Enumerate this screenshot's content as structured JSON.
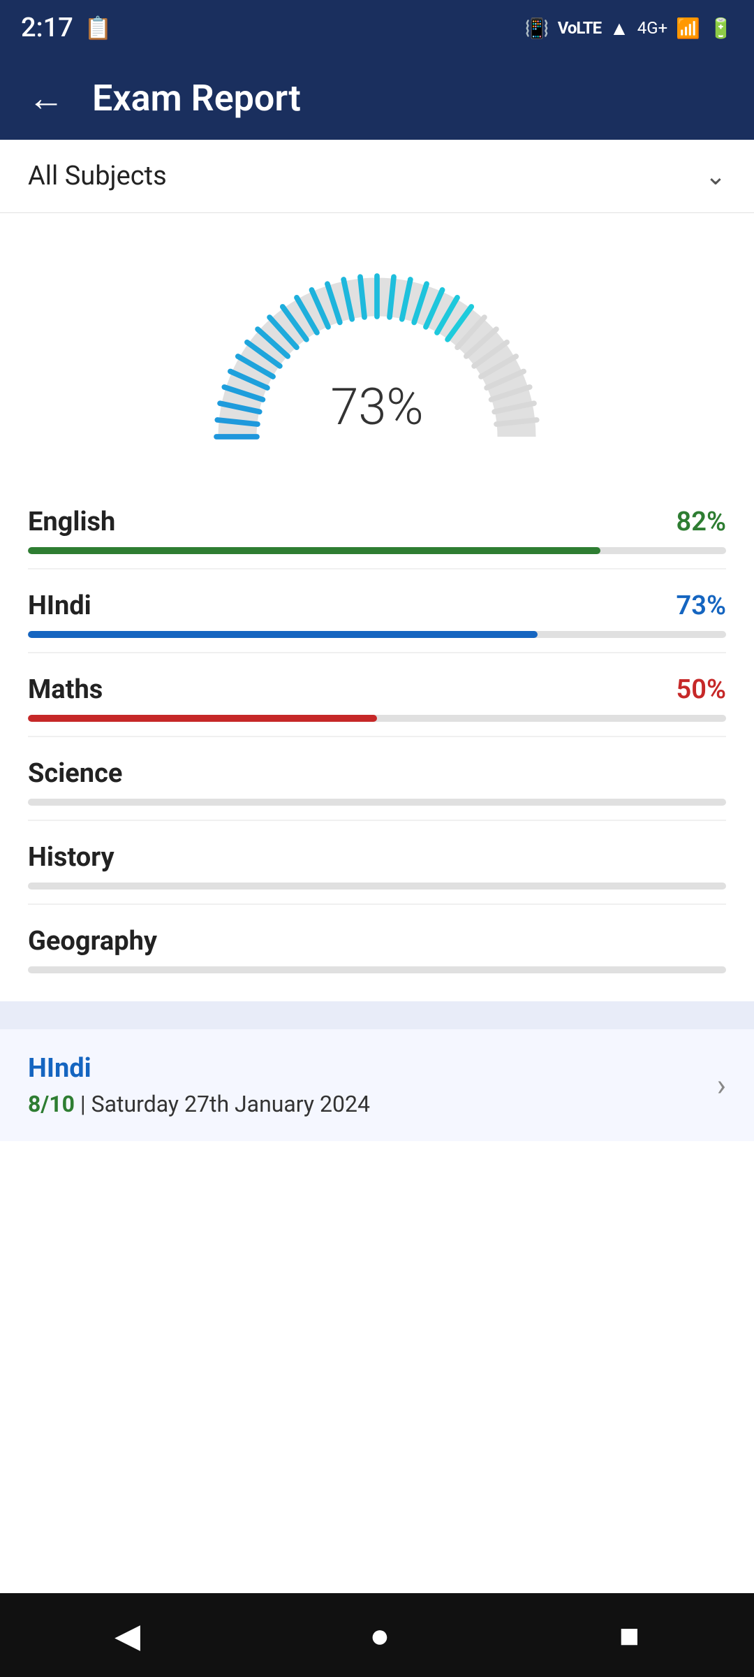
{
  "statusBar": {
    "time": "2:17",
    "icons": [
      "vibrate",
      "volte",
      "wifi",
      "signal-4g",
      "battery"
    ]
  },
  "header": {
    "title": "Exam Report",
    "backLabel": "←"
  },
  "dropdown": {
    "label": "All Subjects",
    "chevron": "⌄"
  },
  "gauge": {
    "percentage": "73%",
    "value": 73
  },
  "subjects": [
    {
      "name": "English",
      "score": "82%",
      "value": 82,
      "colorClass": "score-green",
      "fillClass": "fill-green"
    },
    {
      "name": "HIndi",
      "score": "73%",
      "value": 73,
      "colorClass": "score-blue",
      "fillClass": "fill-blue"
    },
    {
      "name": "Maths",
      "score": "50%",
      "value": 50,
      "colorClass": "score-red",
      "fillClass": "fill-red"
    },
    {
      "name": "Science",
      "score": "",
      "value": 0,
      "colorClass": "",
      "fillClass": "fill-gray"
    },
    {
      "name": "History",
      "score": "",
      "value": 0,
      "colorClass": "",
      "fillClass": "fill-gray"
    },
    {
      "name": "Geography",
      "score": "",
      "value": 0,
      "colorClass": "",
      "fillClass": "fill-gray"
    }
  ],
  "recentExam": {
    "title": "HIndi",
    "score": "8/10",
    "separator": " | ",
    "date": "Saturday 27th January 2024"
  },
  "bottomNav": {
    "back": "◀",
    "home": "●",
    "square": "■"
  }
}
